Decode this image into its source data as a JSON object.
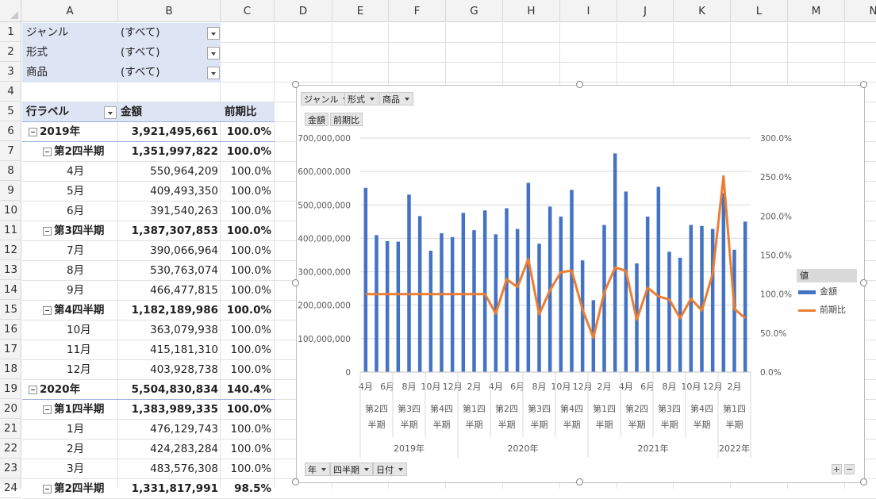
{
  "columns": [
    "A",
    "B",
    "C",
    "D",
    "E",
    "F",
    "G",
    "H",
    "I",
    "J",
    "K",
    "L",
    "M",
    "N"
  ],
  "rows": [
    "1",
    "2",
    "3",
    "4",
    "5",
    "6",
    "7",
    "8",
    "9",
    "10",
    "11",
    "12",
    "13",
    "14",
    "15",
    "16",
    "17",
    "18",
    "19",
    "20",
    "21",
    "22",
    "23",
    "24"
  ],
  "filters": [
    {
      "label": "ジャンル",
      "value": "(すべて)"
    },
    {
      "label": "形式",
      "value": "(すべて)"
    },
    {
      "label": "商品",
      "value": "(すべて)"
    }
  ],
  "pivot_header": {
    "rows_label": "行ラベル",
    "amount": "金額",
    "ratio": "前期比"
  },
  "pivot_rows": [
    {
      "level": 0,
      "label": "2019年",
      "amount": "3,921,495,661",
      "ratio": "100.0%",
      "collapsible": true
    },
    {
      "level": 1,
      "label": "第2四半期",
      "amount": "1,351,997,822",
      "ratio": "100.0%",
      "collapsible": true
    },
    {
      "level": 2,
      "label": "4月",
      "amount": "550,964,209",
      "ratio": "100.0%"
    },
    {
      "level": 2,
      "label": "5月",
      "amount": "409,493,350",
      "ratio": "100.0%"
    },
    {
      "level": 2,
      "label": "6月",
      "amount": "391,540,263",
      "ratio": "100.0%"
    },
    {
      "level": 1,
      "label": "第3四半期",
      "amount": "1,387,307,853",
      "ratio": "100.0%",
      "collapsible": true
    },
    {
      "level": 2,
      "label": "7月",
      "amount": "390,066,964",
      "ratio": "100.0%"
    },
    {
      "level": 2,
      "label": "8月",
      "amount": "530,763,074",
      "ratio": "100.0%"
    },
    {
      "level": 2,
      "label": "9月",
      "amount": "466,477,815",
      "ratio": "100.0%"
    },
    {
      "level": 1,
      "label": "第4四半期",
      "amount": "1,182,189,986",
      "ratio": "100.0%",
      "collapsible": true
    },
    {
      "level": 2,
      "label": "10月",
      "amount": "363,079,938",
      "ratio": "100.0%"
    },
    {
      "level": 2,
      "label": "11月",
      "amount": "415,181,310",
      "ratio": "100.0%"
    },
    {
      "level": 2,
      "label": "12月",
      "amount": "403,928,738",
      "ratio": "100.0%"
    },
    {
      "level": 0,
      "label": "2020年",
      "amount": "5,504,830,834",
      "ratio": "140.4%",
      "collapsible": true
    },
    {
      "level": 1,
      "label": "第1四半期",
      "amount": "1,383,989,335",
      "ratio": "100.0%",
      "collapsible": true
    },
    {
      "level": 2,
      "label": "1月",
      "amount": "476,129,743",
      "ratio": "100.0%"
    },
    {
      "level": 2,
      "label": "2月",
      "amount": "424,283,284",
      "ratio": "100.0%"
    },
    {
      "level": 2,
      "label": "3月",
      "amount": "483,576,308",
      "ratio": "100.0%"
    },
    {
      "level": 1,
      "label": "第2四半期",
      "amount": "1,331,817,991",
      "ratio": "98.5%",
      "collapsible": true
    }
  ],
  "chart_buttons": {
    "top_filters": [
      "ジャンル",
      "形式",
      "商品"
    ],
    "values": [
      "金額",
      "前期比"
    ],
    "axis_fields": [
      "年",
      "四半期",
      "日付"
    ],
    "plus": "+",
    "minus": "−"
  },
  "legend": {
    "title": "値",
    "items": [
      {
        "name": "金額",
        "color": "#4472c4"
      },
      {
        "name": "前期比",
        "color": "#ed7d31"
      }
    ]
  },
  "chart_data": {
    "type": "bar",
    "combo": "bar + line (secondary axis)",
    "categories": [
      "4月",
      "5月",
      "6月",
      "7月",
      "8月",
      "9月",
      "10月",
      "11月",
      "12月",
      "1月",
      "2月",
      "3月",
      "4月",
      "5月",
      "6月",
      "7月",
      "8月",
      "9月",
      "10月",
      "11月",
      "12月",
      "1月",
      "2月",
      "3月",
      "4月",
      "5月",
      "6月",
      "7月",
      "8月",
      "9月",
      "10月",
      "11月",
      "12月",
      "1月",
      "2月",
      "3月"
    ],
    "tick_labels": [
      "4月",
      "6月",
      "8月",
      "10月",
      "12月",
      "2月",
      "4月",
      "6月",
      "8月",
      "10月",
      "12月",
      "2月",
      "4月",
      "6月",
      "8月",
      "10月",
      "12月",
      "2月"
    ],
    "quarter_labels": [
      "第2四半期",
      "第3四半期",
      "第4四半期",
      "第1四半期",
      "第2四半期",
      "第3四半期",
      "第4四半期",
      "第1四半期",
      "第2四半期",
      "第3四半期",
      "第4四半期",
      "第1四半期"
    ],
    "year_labels": [
      "2019年",
      "2020年",
      "2021年",
      "2022年"
    ],
    "series": [
      {
        "name": "金額",
        "axis": "primary",
        "values": [
          550964209,
          409493350,
          391540263,
          390066964,
          530763074,
          466477815,
          363079938,
          415181310,
          403928738,
          476129743,
          424283284,
          483576308,
          412000000,
          490000000,
          428000000,
          566000000,
          384000000,
          495000000,
          465000000,
          545000000,
          334000000,
          215000000,
          440000000,
          654000000,
          540000000,
          325000000,
          465000000,
          554000000,
          360000000,
          342000000,
          440000000,
          437000000,
          428000000,
          536000000,
          366000000,
          450000000
        ]
      },
      {
        "name": "前期比",
        "axis": "secondary",
        "values": [
          1.0,
          1.0,
          1.0,
          1.0,
          1.0,
          1.0,
          1.0,
          1.0,
          1.0,
          1.0,
          1.0,
          1.0,
          0.75,
          1.19,
          1.09,
          1.45,
          0.74,
          1.05,
          1.28,
          1.3,
          0.8,
          0.44,
          1.02,
          1.34,
          1.3,
          0.67,
          1.08,
          0.97,
          0.93,
          0.69,
          0.94,
          0.79,
          1.26,
          2.51,
          0.81,
          0.69
        ]
      }
    ],
    "y_ticks": [
      "0",
      "100,000,000",
      "200,000,000",
      "300,000,000",
      "400,000,000",
      "500,000,000",
      "600,000,000",
      "700,000,000"
    ],
    "y2_ticks": [
      "0.0%",
      "50.0%",
      "100.0%",
      "150.0%",
      "200.0%",
      "250.0%",
      "300.0%"
    ],
    "ylim": [
      0,
      700000000
    ],
    "y2lim": [
      0,
      3.0
    ],
    "grid": true,
    "legend_position": "right"
  }
}
